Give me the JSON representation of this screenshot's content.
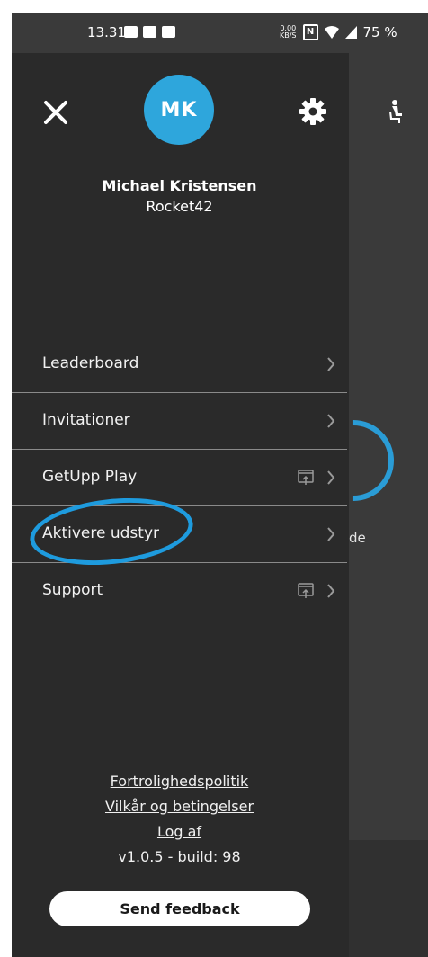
{
  "status_bar": {
    "time": "13.31",
    "net_speed_top": "0.00",
    "net_speed_bottom": "KB/S",
    "nfc": "N",
    "battery": "75 %"
  },
  "user": {
    "initials": "MK",
    "name": "Michael Kristensen",
    "team": "Rocket42"
  },
  "menu": {
    "items": [
      {
        "label": "Leaderboard",
        "external": false
      },
      {
        "label": "Invitationer",
        "external": false
      },
      {
        "label": "GetUpp Play",
        "external": true
      },
      {
        "label": "Aktivere udstyr",
        "external": false,
        "highlighted": true
      },
      {
        "label": "Support",
        "external": true
      }
    ]
  },
  "footer": {
    "privacy_link": "Fortrolighedspolitik",
    "terms_link": "Vilkår og betingelser",
    "logout_link": "Log af",
    "version": "v1.0.5 - build: 98",
    "feedback_button": "Send feedback"
  },
  "background": {
    "partial_label": "de"
  },
  "colors": {
    "avatar": "#2ea6dc",
    "highlight": "#1e9bde",
    "drawer": "#2a2a2a"
  },
  "icons": {
    "close": "close-icon",
    "settings": "gear-icon",
    "chevron": "chevron-right-icon",
    "external": "open-external-icon",
    "person": "person-seated-icon"
  }
}
